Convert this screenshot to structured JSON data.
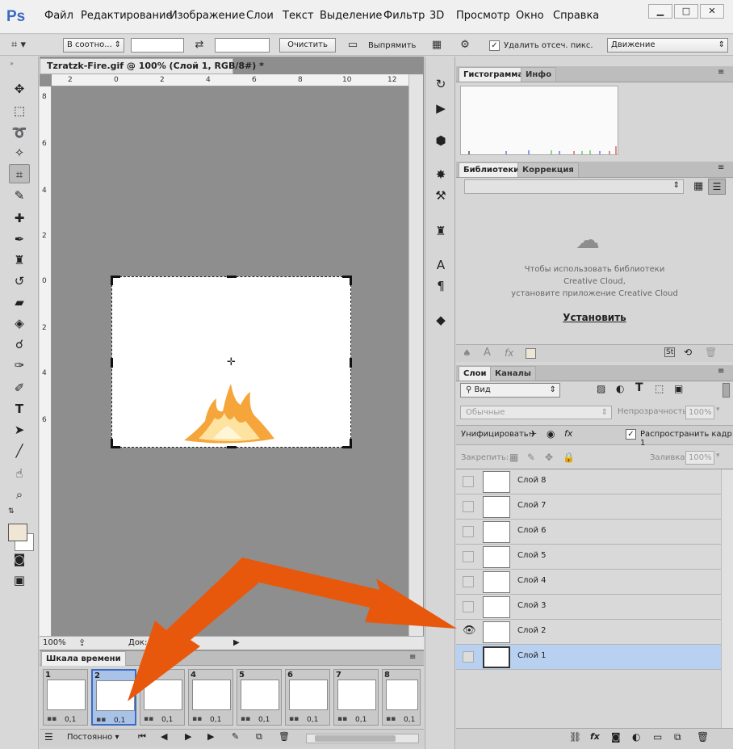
{
  "menubar": {
    "logo": "Ps",
    "items": [
      "Файл",
      "Редактирование",
      "Изображение",
      "Слои",
      "Текст",
      "Выделение",
      "Фильтр",
      "3D",
      "Просмотр",
      "Окно",
      "Справка"
    ],
    "window_buttons": [
      "▁",
      "□",
      "✕"
    ]
  },
  "options": {
    "ratio_label": "В соотно...",
    "ratio_width": "",
    "ratio_height": "",
    "clear_label": "Очистить",
    "straighten_label": "Выпрямить",
    "delete_cropped_label": "Удалить отсеч. пикс.",
    "delete_cropped_checked": true,
    "mode_label": "Движение"
  },
  "document": {
    "tab_title": "Tzratzk-Fire.gif @ 100% (Слой 1, RGB/8#) *",
    "ruler_h": [
      "2",
      "0",
      "2",
      "4",
      "6",
      "8",
      "10",
      "12"
    ],
    "ruler_v": [
      "8",
      "6",
      "4",
      "2",
      "0",
      "2",
      "4",
      "6"
    ],
    "zoom": "100%",
    "doc_label": "Док:"
  },
  "timeline": {
    "title": "Шкала времени",
    "frames": [
      {
        "num": "1",
        "dur": "0,1"
      },
      {
        "num": "2",
        "dur": "0,1"
      },
      {
        "num": "3",
        "dur": "0,1"
      },
      {
        "num": "4",
        "dur": "0,1"
      },
      {
        "num": "5",
        "dur": "0,1"
      },
      {
        "num": "6",
        "dur": "0,1"
      },
      {
        "num": "7",
        "dur": "0,1"
      },
      {
        "num": "8",
        "dur": "0,1"
      }
    ],
    "selected_frame": 2,
    "loop_label": "Постоянно"
  },
  "histogram": {
    "tabs": [
      "Гистограмма",
      "Инфо"
    ]
  },
  "libraries": {
    "tabs": [
      "Библиотеки",
      "Коррекция"
    ],
    "message_line1": "Чтобы использовать библиотеки",
    "message_line2": "Creative Cloud,",
    "message_line3": "установите приложение Creative Cloud",
    "install_label": "Установить"
  },
  "layers": {
    "tabs": [
      "Слои",
      "Каналы"
    ],
    "filter_label": "Вид",
    "blend_mode": "Обычные",
    "opacity_label": "Непрозрачность:",
    "opacity_value": "100%",
    "unify_label": "Унифицировать:",
    "propagate_label": "Распространить кадр 1",
    "propagate_checked": true,
    "lock_label": "Закрепить:",
    "fill_label": "Заливка:",
    "fill_value": "100%",
    "items": [
      {
        "name": "Слой 8",
        "visible": false
      },
      {
        "name": "Слой 7",
        "visible": false
      },
      {
        "name": "Слой 6",
        "visible": false
      },
      {
        "name": "Слой 5",
        "visible": false
      },
      {
        "name": "Слой 4",
        "visible": false
      },
      {
        "name": "Слой 3",
        "visible": false
      },
      {
        "name": "Слой 2",
        "visible": true
      },
      {
        "name": "Слой 1",
        "visible": false
      }
    ],
    "selected_index": 7
  },
  "colors": {
    "accent_arrow": "#e8580c",
    "selection_blue": "#b9d1f0",
    "flame_orange": "#f08a1c"
  }
}
